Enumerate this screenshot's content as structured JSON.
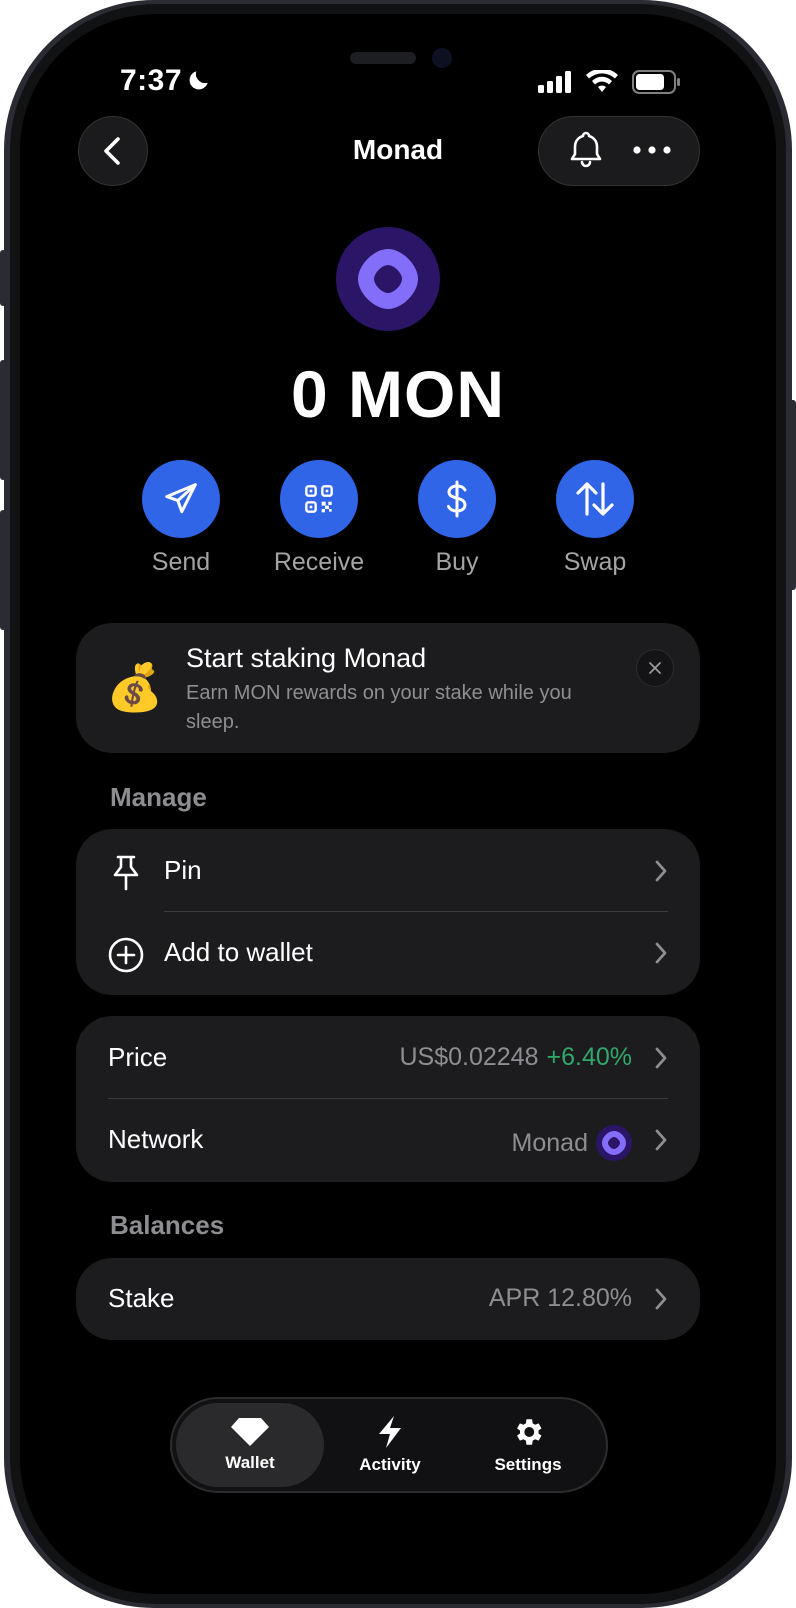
{
  "status_bar": {
    "time": "7:37"
  },
  "header": {
    "title": "Monad"
  },
  "asset": {
    "balance": "0 MON"
  },
  "actions": [
    {
      "label": "Send",
      "icon": "send-icon"
    },
    {
      "label": "Receive",
      "icon": "qr-code-icon"
    },
    {
      "label": "Buy",
      "icon": "dollar-icon"
    },
    {
      "label": "Swap",
      "icon": "swap-arrows-icon"
    }
  ],
  "promo": {
    "emoji": "💰",
    "title": "Start staking Monad",
    "description": "Earn MON rewards on your stake while you sleep."
  },
  "manage": {
    "label": "Manage",
    "items": [
      {
        "label": "Pin",
        "icon": "pin-icon"
      },
      {
        "label": "Add to wallet",
        "icon": "plus-circle-icon"
      }
    ]
  },
  "info": {
    "price": {
      "label": "Price",
      "value": "US$0.02248",
      "change": "+6.40%",
      "change_color": "#2fa86a"
    },
    "network": {
      "label": "Network",
      "value": "Monad"
    }
  },
  "balances": {
    "label": "Balances",
    "stake": {
      "label": "Stake",
      "value": "APR 12.80%"
    }
  },
  "tabbar": {
    "items": [
      {
        "label": "Wallet",
        "icon": "gem-icon",
        "active": true
      },
      {
        "label": "Activity",
        "icon": "lightning-icon",
        "active": false
      },
      {
        "label": "Settings",
        "icon": "gear-icon",
        "active": false
      }
    ]
  },
  "colors": {
    "accent": "#3065e8",
    "monad_purple": "#836ef9",
    "card": "#1c1c1e"
  }
}
